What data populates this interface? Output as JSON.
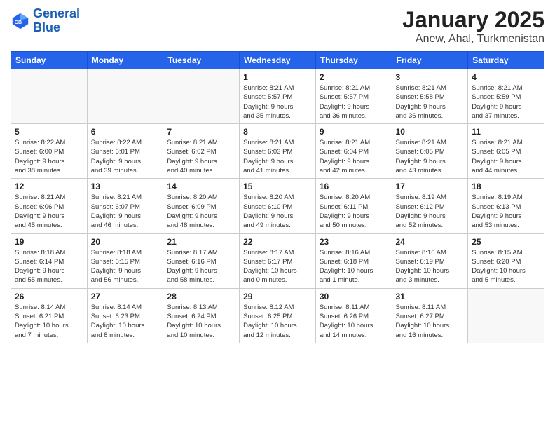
{
  "logo": {
    "line1": "General",
    "line2": "Blue"
  },
  "title": "January 2025",
  "subtitle": "Anew, Ahal, Turkmenistan",
  "weekdays": [
    "Sunday",
    "Monday",
    "Tuesday",
    "Wednesday",
    "Thursday",
    "Friday",
    "Saturday"
  ],
  "weeks": [
    [
      {
        "day": "",
        "info": ""
      },
      {
        "day": "",
        "info": ""
      },
      {
        "day": "",
        "info": ""
      },
      {
        "day": "1",
        "info": "Sunrise: 8:21 AM\nSunset: 5:57 PM\nDaylight: 9 hours\nand 35 minutes."
      },
      {
        "day": "2",
        "info": "Sunrise: 8:21 AM\nSunset: 5:57 PM\nDaylight: 9 hours\nand 36 minutes."
      },
      {
        "day": "3",
        "info": "Sunrise: 8:21 AM\nSunset: 5:58 PM\nDaylight: 9 hours\nand 36 minutes."
      },
      {
        "day": "4",
        "info": "Sunrise: 8:21 AM\nSunset: 5:59 PM\nDaylight: 9 hours\nand 37 minutes."
      }
    ],
    [
      {
        "day": "5",
        "info": "Sunrise: 8:22 AM\nSunset: 6:00 PM\nDaylight: 9 hours\nand 38 minutes."
      },
      {
        "day": "6",
        "info": "Sunrise: 8:22 AM\nSunset: 6:01 PM\nDaylight: 9 hours\nand 39 minutes."
      },
      {
        "day": "7",
        "info": "Sunrise: 8:21 AM\nSunset: 6:02 PM\nDaylight: 9 hours\nand 40 minutes."
      },
      {
        "day": "8",
        "info": "Sunrise: 8:21 AM\nSunset: 6:03 PM\nDaylight: 9 hours\nand 41 minutes."
      },
      {
        "day": "9",
        "info": "Sunrise: 8:21 AM\nSunset: 6:04 PM\nDaylight: 9 hours\nand 42 minutes."
      },
      {
        "day": "10",
        "info": "Sunrise: 8:21 AM\nSunset: 6:05 PM\nDaylight: 9 hours\nand 43 minutes."
      },
      {
        "day": "11",
        "info": "Sunrise: 8:21 AM\nSunset: 6:05 PM\nDaylight: 9 hours\nand 44 minutes."
      }
    ],
    [
      {
        "day": "12",
        "info": "Sunrise: 8:21 AM\nSunset: 6:06 PM\nDaylight: 9 hours\nand 45 minutes."
      },
      {
        "day": "13",
        "info": "Sunrise: 8:21 AM\nSunset: 6:07 PM\nDaylight: 9 hours\nand 46 minutes."
      },
      {
        "day": "14",
        "info": "Sunrise: 8:20 AM\nSunset: 6:09 PM\nDaylight: 9 hours\nand 48 minutes."
      },
      {
        "day": "15",
        "info": "Sunrise: 8:20 AM\nSunset: 6:10 PM\nDaylight: 9 hours\nand 49 minutes."
      },
      {
        "day": "16",
        "info": "Sunrise: 8:20 AM\nSunset: 6:11 PM\nDaylight: 9 hours\nand 50 minutes."
      },
      {
        "day": "17",
        "info": "Sunrise: 8:19 AM\nSunset: 6:12 PM\nDaylight: 9 hours\nand 52 minutes."
      },
      {
        "day": "18",
        "info": "Sunrise: 8:19 AM\nSunset: 6:13 PM\nDaylight: 9 hours\nand 53 minutes."
      }
    ],
    [
      {
        "day": "19",
        "info": "Sunrise: 8:18 AM\nSunset: 6:14 PM\nDaylight: 9 hours\nand 55 minutes."
      },
      {
        "day": "20",
        "info": "Sunrise: 8:18 AM\nSunset: 6:15 PM\nDaylight: 9 hours\nand 56 minutes."
      },
      {
        "day": "21",
        "info": "Sunrise: 8:17 AM\nSunset: 6:16 PM\nDaylight: 9 hours\nand 58 minutes."
      },
      {
        "day": "22",
        "info": "Sunrise: 8:17 AM\nSunset: 6:17 PM\nDaylight: 10 hours\nand 0 minutes."
      },
      {
        "day": "23",
        "info": "Sunrise: 8:16 AM\nSunset: 6:18 PM\nDaylight: 10 hours\nand 1 minute."
      },
      {
        "day": "24",
        "info": "Sunrise: 8:16 AM\nSunset: 6:19 PM\nDaylight: 10 hours\nand 3 minutes."
      },
      {
        "day": "25",
        "info": "Sunrise: 8:15 AM\nSunset: 6:20 PM\nDaylight: 10 hours\nand 5 minutes."
      }
    ],
    [
      {
        "day": "26",
        "info": "Sunrise: 8:14 AM\nSunset: 6:21 PM\nDaylight: 10 hours\nand 7 minutes."
      },
      {
        "day": "27",
        "info": "Sunrise: 8:14 AM\nSunset: 6:23 PM\nDaylight: 10 hours\nand 8 minutes."
      },
      {
        "day": "28",
        "info": "Sunrise: 8:13 AM\nSunset: 6:24 PM\nDaylight: 10 hours\nand 10 minutes."
      },
      {
        "day": "29",
        "info": "Sunrise: 8:12 AM\nSunset: 6:25 PM\nDaylight: 10 hours\nand 12 minutes."
      },
      {
        "day": "30",
        "info": "Sunrise: 8:11 AM\nSunset: 6:26 PM\nDaylight: 10 hours\nand 14 minutes."
      },
      {
        "day": "31",
        "info": "Sunrise: 8:11 AM\nSunset: 6:27 PM\nDaylight: 10 hours\nand 16 minutes."
      },
      {
        "day": "",
        "info": ""
      }
    ]
  ]
}
